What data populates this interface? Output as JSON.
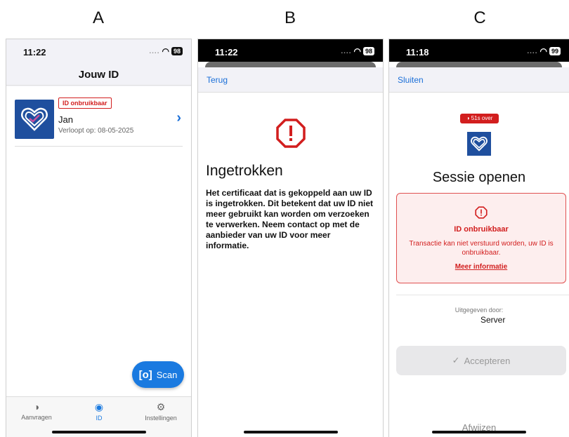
{
  "labels": {
    "a": "A",
    "b": "B",
    "c": "C"
  },
  "phoneA": {
    "time": "11:22",
    "battery": "98",
    "header_title": "Jouw ID",
    "card": {
      "badge": "ID onbruikbaar",
      "name": "Jan",
      "expiry": "Verloopt op: 08-05-2025"
    },
    "scan_label": "Scan",
    "tabs": [
      {
        "label": "Aanvragen",
        "icon": "requests-icon"
      },
      {
        "label": "ID",
        "icon": "person-icon"
      },
      {
        "label": "Instellingen",
        "icon": "gear-icon"
      }
    ]
  },
  "phoneB": {
    "time": "11:22",
    "battery": "98",
    "back_label": "Terug",
    "title": "Ingetrokken",
    "body": "Het certificaat dat is gekoppeld aan uw ID is ingetrokken. Dit betekent dat uw ID niet meer gebruikt kan worden om verzoeken te verwerken. Neem contact op met de aanbieder van uw ID voor meer informatie."
  },
  "phoneC": {
    "time": "11:18",
    "battery": "99",
    "close_label": "Sluiten",
    "timer": "51s over",
    "title": "Sessie openen",
    "error": {
      "title": "ID onbruikbaar",
      "text": "Transactie kan niet verstuurd worden, uw ID is onbruikbaar.",
      "link": "Meer informatie"
    },
    "issued_label": "Uitgegeven door:",
    "issued_value": "Server",
    "accept_label": "Accepteren",
    "reject_label": "Afwijzen"
  },
  "colors": {
    "accent_blue": "#1a7ae0",
    "error_red": "#d21e1e",
    "id_blue": "#1f4f9e"
  }
}
